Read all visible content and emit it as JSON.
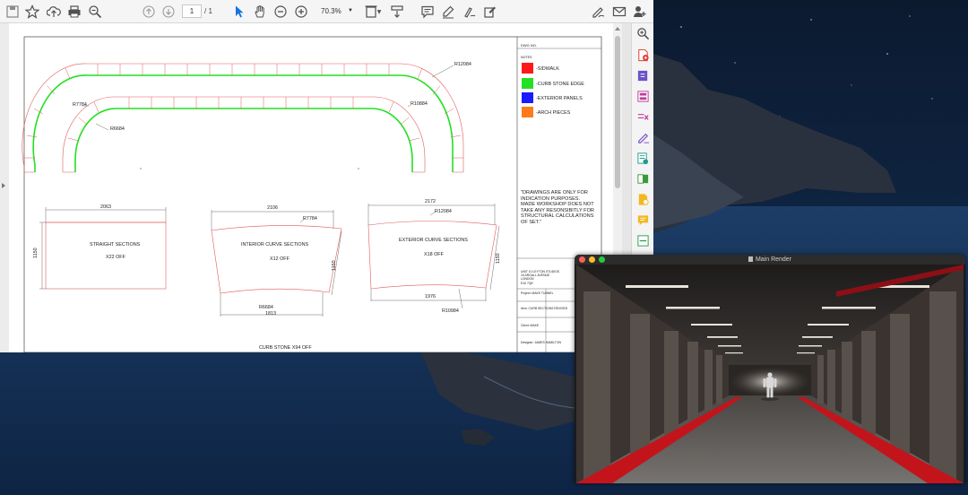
{
  "toolbar": {
    "page_current": "1",
    "page_total": "/ 1",
    "zoom": "70.3%"
  },
  "drawing": {
    "dims": {
      "r12084": "R12084",
      "r10884": "R10884",
      "r7784": "R7784",
      "r6684": "R6684",
      "straight_width": "2063",
      "straight_height": "1150",
      "interior_width": "2106",
      "interior_r_outer": "R7784",
      "interior_height": "1150",
      "interior_r_inner": "R6684",
      "interior_bottom": "1813",
      "exterior_width": "2172",
      "exterior_r_outer": "R12084",
      "exterior_height": "1150",
      "exterior_bottom": "1976",
      "exterior_r_inner": "R10984"
    },
    "straight": {
      "title": "STRAIGHT SECTIONS",
      "count": "X22 OFF"
    },
    "interior": {
      "title": "INTERIOR CURVE SECTIONS",
      "count": "X12 OFF"
    },
    "exterior": {
      "title": "EXTERIOR CURVE SECTIONS",
      "count": "X18 OFF"
    },
    "footer": "CURB STONE X94 OFF"
  },
  "titleblock": {
    "dwg_no": "DWG NO.",
    "notes": "NOTES",
    "legend": [
      {
        "label": "-SIDWALK",
        "color": "#ff1a1a"
      },
      {
        "label": "-CURB STONE EDGE",
        "color": "#22e022"
      },
      {
        "label": "-EXTERIOR PANELS",
        "color": "#1a1aff"
      },
      {
        "label": "-ARCH PIECES",
        "color": "#ff7a1a"
      }
    ],
    "disclaimer_lines": [
      "\"DRAWINGS ARE ONLY FOR",
      "INDICATION PURPOSES.",
      "MADE WORKSHOP DOES NOT",
      "TAKE ANY RESONSIBITLY FOR",
      "STRUCTURAL CALCULATIONS",
      "OF SET.\""
    ],
    "address_lines": [
      "UNIT 10 LEYTON STUDIOS",
      "15 ARGALL AVENUE",
      "LONDON",
      "E10 7QE"
    ],
    "project": "Project: MAKE TUNNEL",
    "item": "Item: CURB SECTIONS REVISED",
    "client": "Client: MAKE",
    "designer": "Designer: JAMES HAMILTON"
  },
  "render": {
    "title": "Main Render"
  },
  "colors": {
    "curb_edge": "#22e022",
    "cut_line": "#e05a5a",
    "dim_line": "#444444",
    "tunnel_stripe": "#c4141b"
  }
}
